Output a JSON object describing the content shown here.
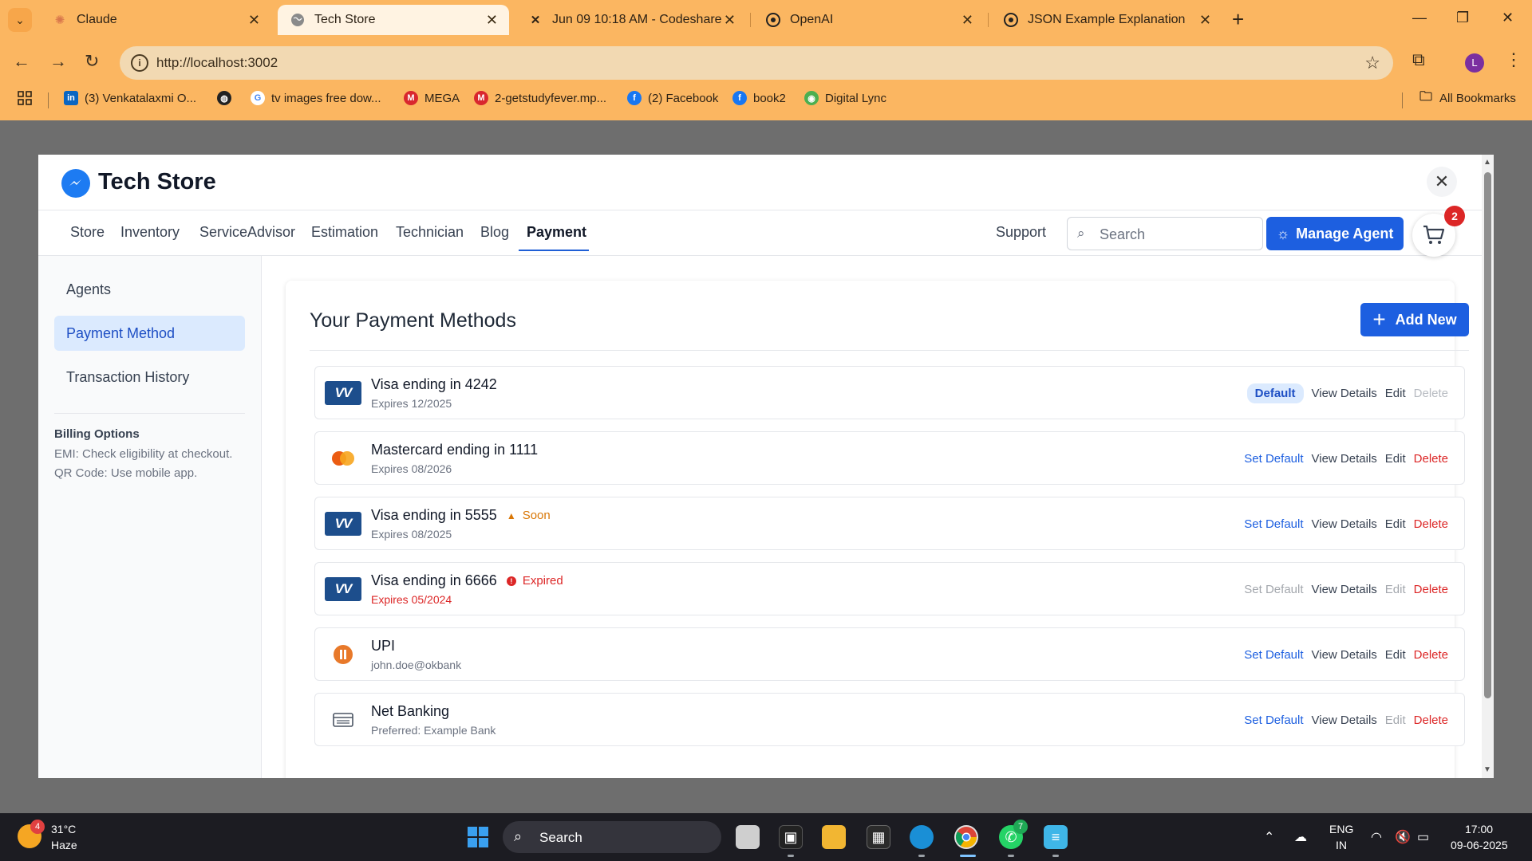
{
  "browser": {
    "tabs": [
      {
        "title": "Claude",
        "favicon": "claude-icon",
        "active": false
      },
      {
        "title": "Tech Store",
        "favicon": "globe-icon",
        "active": true
      },
      {
        "title": "Jun 09 10:18 AM - Codeshare",
        "favicon": "codeshare-icon",
        "active": false
      },
      {
        "title": "OpenAI",
        "favicon": "openai-icon",
        "active": false
      },
      {
        "title": "JSON Example Explanation",
        "favicon": "openai-icon",
        "active": false
      }
    ],
    "url": "http://localhost:3002",
    "profile_initial": "L",
    "bookmarks": [
      {
        "label": "(3) Venkatalaxmi O...",
        "icon": "linkedin-icon",
        "color": "#0a66c2"
      },
      {
        "label": "",
        "icon": "globe-icon",
        "color": "#222222"
      },
      {
        "label": "tv images free dow...",
        "icon": "google-icon",
        "color": "#ffffff"
      },
      {
        "label": "MEGA",
        "icon": "mega-icon",
        "color": "#d9272e"
      },
      {
        "label": "2-getstudyfever.mp...",
        "icon": "mega-icon",
        "color": "#d9272e"
      },
      {
        "label": "(2) Facebook",
        "icon": "facebook-icon",
        "color": "#1877f2"
      },
      {
        "label": "book2",
        "icon": "facebook-icon",
        "color": "#1877f2"
      },
      {
        "label": "Digital Lync",
        "icon": "digital-lync-icon",
        "color": "#4caf50"
      }
    ],
    "all_bookmarks": "All Bookmarks"
  },
  "app": {
    "title": "Tech Store",
    "nav": [
      "Store",
      "Inventory",
      "ServiceAdvisor",
      "Estimation",
      "Technician",
      "Blog",
      "Payment"
    ],
    "active_nav": "Payment",
    "support": "Support",
    "search_placeholder": "Search",
    "manage_agent": "Manage Agent",
    "cart_count": "2"
  },
  "sidebar": {
    "items": [
      "Agents",
      "Payment Method",
      "Transaction History"
    ],
    "active": "Payment Method",
    "billing": {
      "title": "Billing Options",
      "lines": [
        "EMI: Check eligibility at checkout.",
        "QR Code: Use mobile app."
      ]
    }
  },
  "main": {
    "title": "Your Payment Methods",
    "add_new": "Add New",
    "methods": [
      {
        "name": "Visa ending in 4242",
        "sub": "Expires 12/2025",
        "icon": "visa-icon",
        "tag": "",
        "is_default": true,
        "labels": {
          "default": "Default",
          "view": "View Details",
          "edit": "Edit",
          "delete": "Delete"
        }
      },
      {
        "name": "Mastercard ending in 1111",
        "sub": "Expires 08/2026",
        "icon": "mastercard-icon",
        "tag": "",
        "labels": {
          "set": "Set Default",
          "view": "View Details",
          "edit": "Edit",
          "delete": "Delete"
        }
      },
      {
        "name": "Visa ending in 5555",
        "sub": "Expires 08/2025",
        "icon": "visa-icon",
        "tag": "Soon",
        "labels": {
          "set": "Set Default",
          "view": "View Details",
          "edit": "Edit",
          "delete": "Delete"
        }
      },
      {
        "name": "Visa ending in 6666",
        "sub": "Expires 05/2024",
        "icon": "visa-icon",
        "tag": "Expired",
        "labels": {
          "set": "Set Default",
          "view": "View Details",
          "edit": "Edit",
          "delete": "Delete"
        }
      },
      {
        "name": "UPI",
        "sub": "john.doe@okbank",
        "icon": "upi-icon",
        "tag": "",
        "labels": {
          "set": "Set Default",
          "view": "View Details",
          "edit": "Edit",
          "delete": "Delete"
        }
      },
      {
        "name": "Net Banking",
        "sub": "Preferred: Example Bank",
        "icon": "bank-icon",
        "tag": "",
        "labels": {
          "set": "Set Default",
          "view": "View Details",
          "edit": "Edit",
          "delete": "Delete"
        }
      }
    ]
  },
  "taskbar": {
    "weather_temp": "31°C",
    "weather_desc": "Haze",
    "weather_badge": "4",
    "search": "Search",
    "whatsapp_badge": "7",
    "lang1": "ENG",
    "lang2": "IN",
    "time": "17:00",
    "date": "09-06-2025"
  },
  "colors": {
    "accent": "#1d5fe0",
    "danger": "#dc2626",
    "warning": "#d97706",
    "chrome_orange": "#fbb661"
  }
}
